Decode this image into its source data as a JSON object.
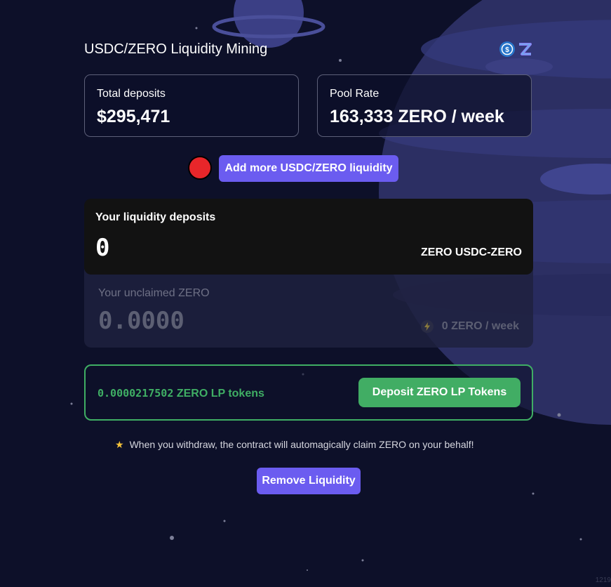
{
  "header": {
    "title": "USDC/ZERO Liquidity Mining",
    "logo_icons": [
      "usdc-icon",
      "zero-icon"
    ]
  },
  "stats": {
    "total_deposits_label": "Total deposits",
    "total_deposits_value": "$295,471",
    "pool_rate_label": "Pool Rate",
    "pool_rate_value": "163,333 ZERO / week"
  },
  "actions": {
    "add_liquidity_label": "Add more USDC/ZERO liquidity",
    "remove_liquidity_label": "Remove Liquidity",
    "deposit_lp_label": "Deposit ZERO LP Tokens"
  },
  "deposits": {
    "label": "Your liquidity deposits",
    "value": "0",
    "unit": "ZERO USDC-ZERO"
  },
  "unclaimed": {
    "label": "Your unclaimed ZERO",
    "value": "0.0000",
    "rate": "0 ZERO / week",
    "rate_icon": "bolt-icon"
  },
  "lp_tokens": {
    "amount": "0.0000217502",
    "suffix": " ZERO LP tokens"
  },
  "note": {
    "icon": "star-icon",
    "text": "When you withdraw, the contract will automagically claim ZERO on your behalf!"
  },
  "corner_text": "1219",
  "colors": {
    "background": "#0d1029",
    "accent_purple": "#6b5cf0",
    "accent_green": "#41ad64",
    "alert_red": "#e8262a"
  }
}
